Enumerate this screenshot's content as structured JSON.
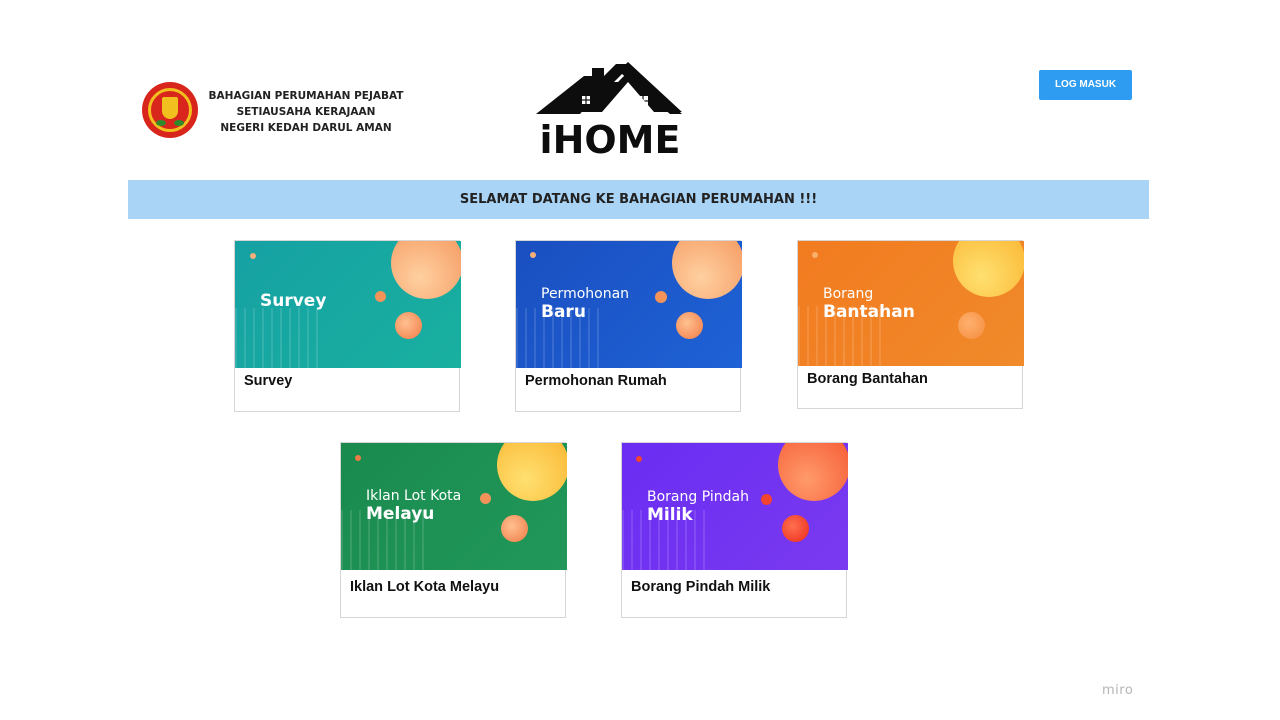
{
  "org": {
    "line1": "BAHAGIAN PERUMAHAN PEJABAT",
    "line2": "SETIAUSAHA KERAJAAN",
    "line3": "NEGERI KEDAH DARUL AMAN"
  },
  "logo": {
    "word": "iHOME"
  },
  "header": {
    "login_label": "LOG MASUK"
  },
  "welcome": {
    "text": "SELAMAT DATANG KE BAHAGIAN PERUMAHAN !!!"
  },
  "cards": [
    {
      "banner_line1": "",
      "banner_line2": "Survey",
      "caption": "Survey",
      "color": "#17a2a2"
    },
    {
      "banner_line1": "Permohonan",
      "banner_line2": "Baru",
      "caption": "Permohonan Rumah",
      "color": "#1b58c8"
    },
    {
      "banner_line1": "Borang",
      "banner_line2": "Bantahan",
      "caption": "Borang Bantahan",
      "color": "#f07a22"
    },
    {
      "banner_line1": "Iklan Lot Kota",
      "banner_line2": "Melayu",
      "caption": "Iklan Lot Kota Melayu",
      "color": "#1e9150"
    },
    {
      "banner_line1": "Borang Pindah",
      "banner_line2": "Milik",
      "caption": "Borang Pindah Milik",
      "color": "#6a2cf0"
    }
  ],
  "watermark": {
    "text": "miro"
  }
}
